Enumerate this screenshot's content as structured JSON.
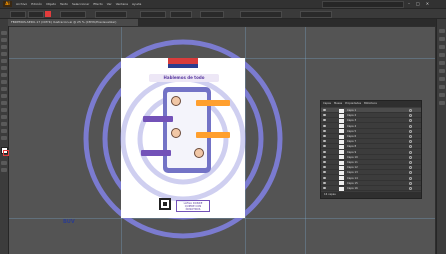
{
  "app": {
    "logo": "Ai",
    "menus": [
      "Archivo",
      "Edición",
      "Objeto",
      "Texto",
      "Seleccionar",
      "Efecto",
      "Ver",
      "Ventana",
      "Ayuda"
    ],
    "window_controls": [
      "–",
      "□",
      "✕"
    ]
  },
  "document_tab": {
    "label": "FBDEMOS-SEDU-17 (CMYK) Ilustracion.ai @ 25 % (CMYK/Previsualizar)"
  },
  "artboard": {
    "title": "Hablemos de todo",
    "cta_text": [
      "LLEGA DONDE",
      "QUIERE CON",
      "NOSOTROS"
    ],
    "brand": "BUV"
  },
  "layers_panel": {
    "tabs": [
      "Capas",
      "Mesas",
      "Propiedades",
      "Biblioteca"
    ],
    "rows": [
      "Capa 1",
      "Capa 2",
      "Capa 3",
      "Capa 4",
      "Capa 5",
      "Capa 6",
      "Capa 7",
      "Capa 8",
      "Capa 9",
      "Capa 10",
      "Capa 11",
      "Capa 12",
      "Capa 13",
      "Capa 14",
      "Capa 15",
      "Capa 16"
    ],
    "footer": "16 capas"
  },
  "colors": {
    "accent": "#ff9a00",
    "ring": "#7b7bd0",
    "orange_bubble": "#ff9f2e",
    "purple_bubble": "#7352b8",
    "phone": "#7373c6"
  }
}
